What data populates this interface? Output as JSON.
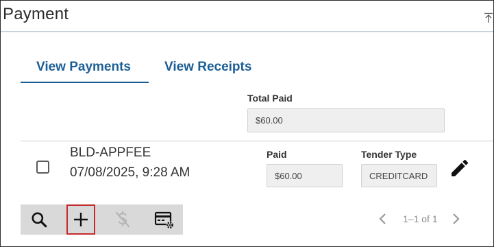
{
  "header": {
    "title": "Payment"
  },
  "tabs": [
    {
      "label": "View Payments",
      "active": true
    },
    {
      "label": "View Receipts",
      "active": false
    }
  ],
  "summary": {
    "total_paid_label": "Total Paid",
    "total_paid_value": "$60.00"
  },
  "payment_row": {
    "fee_code": "BLD-APPFEE",
    "datetime": "07/08/2025, 9:28 AM",
    "paid_label": "Paid",
    "paid_value": "$60.00",
    "tender_type_label": "Tender Type",
    "tender_type_value": "CREDITCARD"
  },
  "toolbar": {
    "icons": [
      "search-icon",
      "add-icon",
      "void-payment-icon",
      "payment-settings-icon"
    ]
  },
  "pager": {
    "text": "1–1 of 1"
  },
  "colors": {
    "accent": "#1b5e96",
    "toolbar_bg": "#d9d9d9",
    "focus_outline": "#c42b2b",
    "field_bg": "#efefef"
  }
}
